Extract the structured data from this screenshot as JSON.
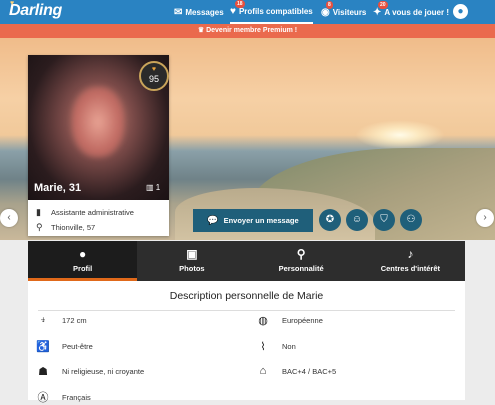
{
  "header": {
    "logo": "Darling",
    "nav": [
      {
        "label": "Messages",
        "icon": "envelope-icon",
        "badge": ""
      },
      {
        "label": "Profils compatibles",
        "icon": "heart-icon",
        "badge": "18"
      },
      {
        "label": "Visiteurs",
        "icon": "visitor-icon",
        "badge": "8"
      },
      {
        "label": "A vous de jouer !",
        "icon": "sparkle-icon",
        "badge": "20"
      }
    ]
  },
  "promo": "Devenir membre Premium !",
  "profile": {
    "name": "Marie, 31",
    "photo_count": "1",
    "score": "95",
    "job": "Assistante administrative",
    "location": "Thionville, 57"
  },
  "actions": {
    "send_message": "Envoyer un message"
  },
  "tabs": [
    {
      "label": "Profil",
      "icon": "person-icon"
    },
    {
      "label": "Photos",
      "icon": "image-icon"
    },
    {
      "label": "Personnalité",
      "icon": "personality-icon"
    },
    {
      "label": "Centres d'intérêt",
      "icon": "guitar-icon"
    }
  ],
  "description": {
    "title": "Description personnelle de Marie",
    "attributes": [
      {
        "icon": "height-icon",
        "value": "172 cm"
      },
      {
        "icon": "globe-icon",
        "value": "Européenne"
      },
      {
        "icon": "stroller-icon",
        "value": "Peut-être"
      },
      {
        "icon": "cigarette-icon",
        "value": "Non"
      },
      {
        "icon": "religion-icon",
        "value": "Ni religieuse, ni croyante"
      },
      {
        "icon": "graduation-icon",
        "value": "BAC+4 / BAC+5"
      },
      {
        "icon": "language-icon",
        "value": "Français"
      }
    ]
  },
  "colors": {
    "topbar": "#2a83c2",
    "promo": "#ea6a4d",
    "action": "#1f5f7a",
    "tab_active": "#e0691a"
  }
}
